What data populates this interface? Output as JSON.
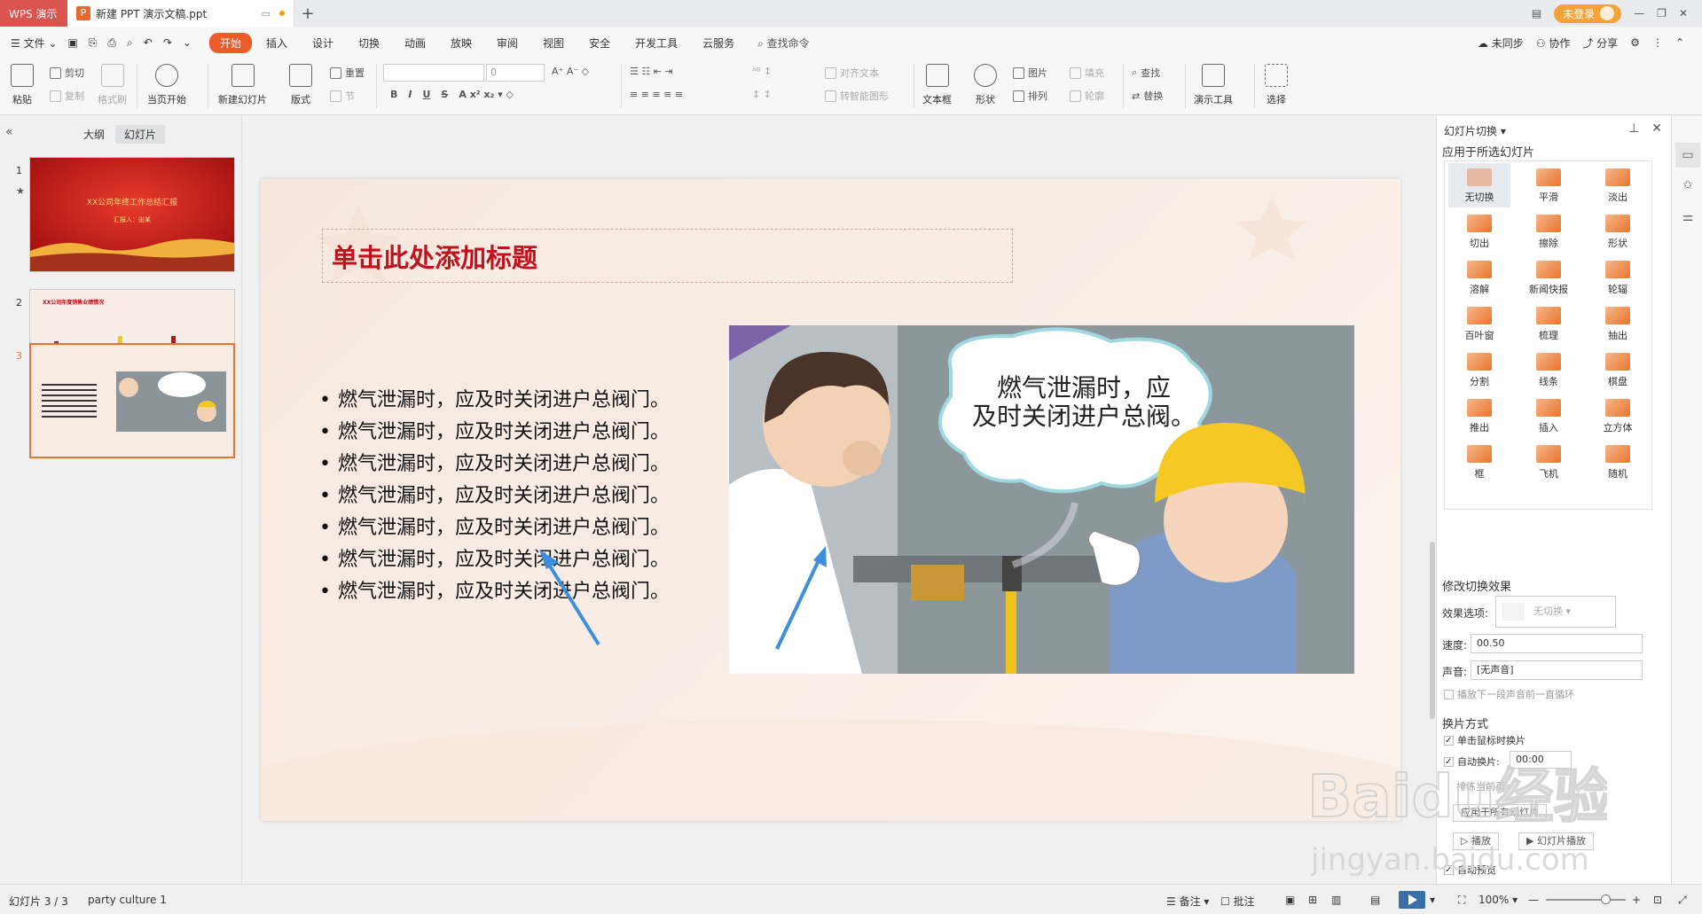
{
  "titlebar": {
    "app_tab": "WPS 演示",
    "doc_tab": "新建 PPT 演示文稿.ppt",
    "login": "未登录"
  },
  "menubar": {
    "file": "文件",
    "tabs": [
      "开始",
      "插入",
      "设计",
      "切换",
      "动画",
      "放映",
      "审阅",
      "视图",
      "安全",
      "开发工具",
      "云服务"
    ],
    "search": "查找命令",
    "right": [
      "未同步",
      "协作",
      "分享"
    ]
  },
  "ribbon": {
    "paste": "粘贴",
    "cut": "剪切",
    "copy": "复制",
    "format_painter": "格式刷",
    "play_from_current": "当页开始",
    "new_slide": "新建幻灯片",
    "layout": "版式",
    "reset": "重置",
    "section": "节",
    "font_size": "0",
    "align_text": "对齐文本",
    "smartart": "转智能图形",
    "text_box": "文本框",
    "shape": "形状",
    "picture": "图片",
    "arrange": "排列",
    "fill": "填充",
    "outline": "轮廓",
    "find": "查找",
    "replace": "替换",
    "presentation_tools": "演示工具",
    "select": "选择"
  },
  "leftpanel": {
    "tab_outline": "大纲",
    "tab_slides": "幻灯片",
    "slides": [
      {
        "num": "1",
        "title": "XX公司年终工作总结汇报",
        "subtitle": "汇报人：张某"
      },
      {
        "num": "2",
        "title": "XX公司年度销售业绩情况"
      },
      {
        "num": "3"
      }
    ]
  },
  "slide": {
    "title_placeholder": "单击此处添加标题",
    "bullets": [
      "燃气泄漏时，应及时关闭进户总阀门。",
      "燃气泄漏时，应及时关闭进户总阀门。",
      "燃气泄漏时，应及时关闭进户总阀门。",
      "燃气泄漏时，应及时关闭进户总阀门。",
      "燃气泄漏时，应及时关闭进户总阀门。",
      "燃气泄漏时，应及时关闭进户总阀门。",
      "燃气泄漏时，应及时关闭进户总阀门。"
    ],
    "bubble_line1": "燃气泄漏时，应",
    "bubble_line2": "及时关闭进户总阀。",
    "title_color": "#c0111d"
  },
  "rightpanel": {
    "header": "幻灯片切换",
    "apply_to": "应用于所选幻灯片",
    "transitions": [
      "无切换",
      "平滑",
      "淡出",
      "切出",
      "擦除",
      "形状",
      "溶解",
      "新闻快报",
      "轮辐",
      "百叶窗",
      "梳理",
      "抽出",
      "分割",
      "线条",
      "棋盘",
      "推出",
      "插入",
      "立方体",
      "框",
      "飞机",
      "随机"
    ],
    "modify_effect": "修改切换效果",
    "effect_option_label": "效果选项:",
    "effect_option_value": "无切换",
    "speed_label": "速度:",
    "speed_value": "00.50",
    "sound_label": "声音:",
    "sound_value": "[无声音]",
    "loop_sound": "播放下一段声音前一直循环",
    "advance": "换片方式",
    "on_click": "单击鼠标时换片",
    "auto_label": "自动换片:",
    "auto_value": "00:00",
    "sort_preview": "排练当前页",
    "apply_all": "应用于所有幻灯片",
    "play": "播放",
    "slideshow": "幻灯片播放",
    "auto_preview": "自动预览"
  },
  "statusbar": {
    "slide_counter": "幻灯片 3 / 3",
    "theme": "party culture 1",
    "notes": "备注",
    "comments": "批注",
    "zoom": "100%"
  },
  "colors": {
    "accent": "#e8742f",
    "wps_red": "#d9534f",
    "start_tab": "#ee5b2a"
  },
  "watermark": {
    "line1": "Baidu经验",
    "line2": "jingyan.baidu.com"
  }
}
